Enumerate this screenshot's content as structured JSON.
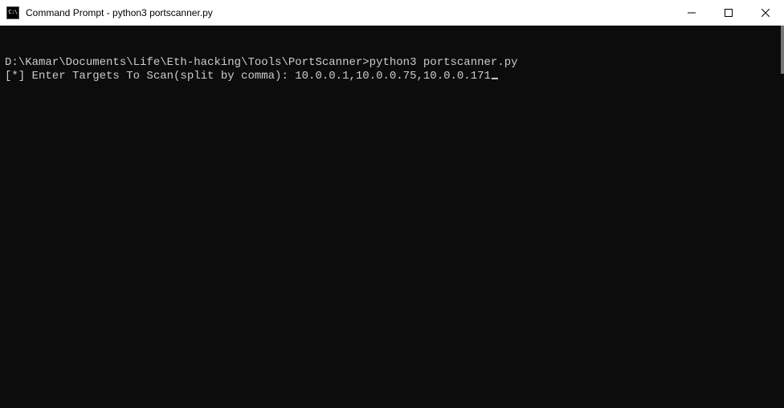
{
  "titlebar": {
    "icon_label": "C:\\",
    "title": "Command Prompt - python3  portscanner.py"
  },
  "terminal": {
    "lines": [
      "D:\\Kamar\\Documents\\Life\\Eth-hacking\\Tools\\PortScanner>python3 portscanner.py",
      "[*] Enter Targets To Scan(split by comma): 10.0.0.1,10.0.0.75,10.0.0.171"
    ]
  }
}
